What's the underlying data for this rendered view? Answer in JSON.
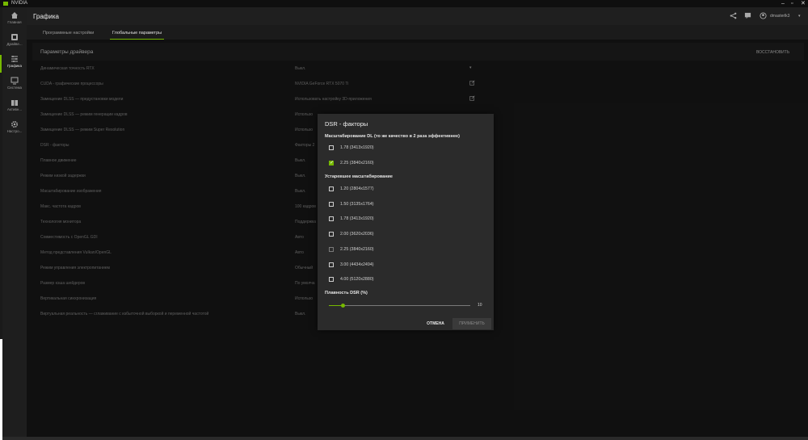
{
  "window": {
    "app_name": "NVIDIA",
    "minimize": "–",
    "maximize": "▫",
    "close": "✕"
  },
  "sidebar": {
    "items": [
      {
        "label": "Главная",
        "icon": "home-icon"
      },
      {
        "label": "Драйве...",
        "icon": "driver-icon"
      },
      {
        "label": "Графика",
        "icon": "sliders-icon"
      },
      {
        "label": "Система",
        "icon": "monitor-icon"
      },
      {
        "label": "Активн...",
        "icon": "gift-icon"
      },
      {
        "label": "Настро...",
        "icon": "gear-icon"
      }
    ]
  },
  "header": {
    "title": "Графика",
    "user": "dmasterlk3"
  },
  "tabs": [
    {
      "label": "Программные настройки"
    },
    {
      "label": "Глобальные параметры"
    }
  ],
  "section": {
    "title": "Параметры драйвера",
    "restore": "ВОССТАНОВИТЬ"
  },
  "rows": [
    {
      "label": "Динамическая точность RTX",
      "value": "Выкл."
    },
    {
      "label": "CUDA - графические процессоры",
      "value": "NVIDIA GeForce RTX 5070 Ti"
    },
    {
      "label": "Замещение DLSS — предустановки модели",
      "value": "Использовать настройку 3D-приложения"
    },
    {
      "label": "Замещение DLSS — режим генерации кадров",
      "value": "Использо"
    },
    {
      "label": "Замещение DLSS — режим Super Resolution",
      "value": "Использо"
    },
    {
      "label": "DSR - факторы",
      "value": "Факторы 2"
    },
    {
      "label": "Плавное движение",
      "value": "Выкл."
    },
    {
      "label": "Режим низкой задержки",
      "value": "Выкл."
    },
    {
      "label": "Масштабирование изображения",
      "value": "Выкл."
    },
    {
      "label": "Макс. частота кадров",
      "value": "100 кадров"
    },
    {
      "label": "Технология монитора",
      "value": "Поддержка"
    },
    {
      "label": "Совместимость с OpenGL GDI",
      "value": "Авто"
    },
    {
      "label": "Метод представления Vulkan/OpenGL",
      "value": "Авто"
    },
    {
      "label": "Режим управления электропитанием",
      "value": "Обычный"
    },
    {
      "label": "Размер кэша шейдеров",
      "value": "По умолча"
    },
    {
      "label": "Вертикальная синхронизация",
      "value": "Использо"
    },
    {
      "label": "Виртуальная реальность — сглаживание с избыточной выборкой и переменной частотой",
      "value": "Выкл."
    }
  ],
  "modal": {
    "title": "DSR - факторы",
    "dl_heading": "Масштабирование DL (то же качество в 2 раза эффективнее)",
    "dl_options": [
      {
        "label": "1.78 (3413x1920)",
        "checked": false
      },
      {
        "label": "2.25 (3840x2160)",
        "checked": true
      }
    ],
    "legacy_heading": "Устаревшее масштабирование",
    "legacy_options": [
      {
        "label": "1.20 (2804x1577)",
        "checked": false
      },
      {
        "label": "1.50 (3135x1764)",
        "checked": false
      },
      {
        "label": "1.78 (3413x1920)",
        "checked": false
      },
      {
        "label": "2.00 (3620x2036)",
        "checked": false
      },
      {
        "label": "2.25 (3840x2160)",
        "checked": false,
        "disabled": true
      },
      {
        "label": "3.00 (4434x2494)",
        "checked": false
      },
      {
        "label": "4.00 (5120x2880)",
        "checked": false
      }
    ],
    "smooth_label": "Плавность DSR (%)",
    "smooth_value": "10",
    "smooth_fraction": 0.1,
    "cancel": "ОТМЕНА",
    "apply": "ПРИМЕНИТЬ"
  },
  "colors": {
    "accent": "#76b900"
  }
}
